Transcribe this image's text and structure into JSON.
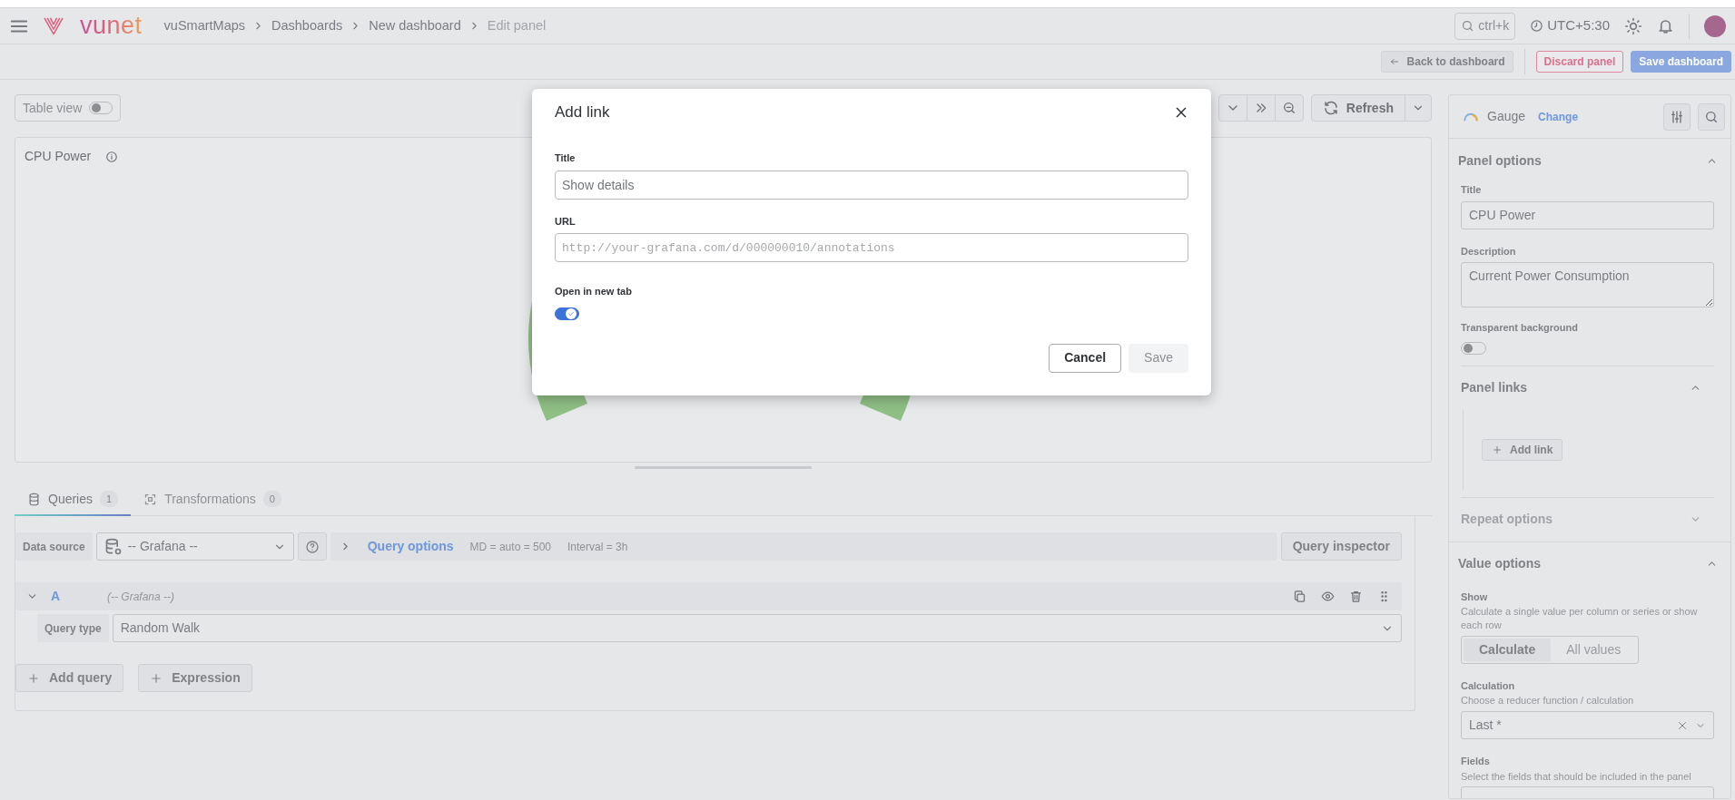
{
  "topbar": {
    "logo": "vunet",
    "breadcrumbs": [
      {
        "label": "vuSmartMaps",
        "current": false
      },
      {
        "label": "Dashboards",
        "current": false
      },
      {
        "label": "New dashboard",
        "current": false
      },
      {
        "label": "Edit panel",
        "current": true
      }
    ],
    "search_placeholder": "ctrl+k",
    "timezone": "UTC+5:30"
  },
  "actions": [
    {
      "label": "Back to dashboard",
      "kind": "back"
    },
    {
      "label": "Discard panel",
      "kind": "danger"
    },
    {
      "label": "Save dashboard",
      "kind": "primary"
    }
  ],
  "table_view": {
    "label": "Table view",
    "on": false
  },
  "time_controls": {
    "refresh": "Refresh"
  },
  "panel": {
    "title": "CPU Power"
  },
  "tabs": [
    {
      "label": "Queries",
      "count": "1",
      "selected": true
    },
    {
      "label": "Transformations",
      "count": "0",
      "selected": false
    }
  ],
  "datasource": {
    "label": "Data source",
    "value": "-- Grafana --"
  },
  "query_options": {
    "label": "Query options",
    "md": "MD = auto = 500",
    "interval": "Interval = 3h",
    "inspector": "Query inspector"
  },
  "queries": [
    {
      "ref": "A",
      "source": "(-- Grafana --)",
      "expanded": true,
      "type_label": "Query type",
      "type_value": "Random Walk"
    }
  ],
  "query_buttons": [
    "Add query",
    "Expression"
  ],
  "options_pane": {
    "visualization": "Gauge",
    "change": "Change",
    "panel_options": {
      "heading": "Panel options",
      "expanded": true,
      "title_label": "Title",
      "title_value": "CPU Power",
      "description_label": "Description",
      "description_value": "Current Power Consumption",
      "transparent_label": "Transparent background",
      "transparent_on": false
    },
    "panel_links": {
      "heading": "Panel links",
      "expanded": true,
      "add_link": "Add link"
    },
    "repeat_options": {
      "heading": "Repeat options",
      "expanded": false
    },
    "value_options": {
      "heading": "Value options",
      "expanded": true,
      "show_label": "Show",
      "show_hint": "Calculate a single value per column or series or show each row",
      "show_choices": [
        {
          "label": "Calculate",
          "selected": true
        },
        {
          "label": "All values",
          "selected": false
        }
      ],
      "calculation_label": "Calculation",
      "calculation_hint": "Choose a reducer function / calculation",
      "calculation_value": "Last *",
      "fields_label": "Fields",
      "fields_hint": "Select the fields that should be included in the panel"
    }
  },
  "dialog": {
    "title": "Add link",
    "fields": [
      {
        "label": "Title",
        "placeholder": "Show details",
        "kind": "text"
      },
      {
        "label": "URL",
        "placeholder": "http://your-grafana.com/d/000000010/annotations",
        "kind": "url"
      }
    ],
    "new_tab_label": "Open in new tab",
    "new_tab_on": true,
    "buttons": [
      {
        "label": "Cancel",
        "kind": "secondary"
      },
      {
        "label": "Save",
        "kind": "disabled"
      }
    ]
  }
}
